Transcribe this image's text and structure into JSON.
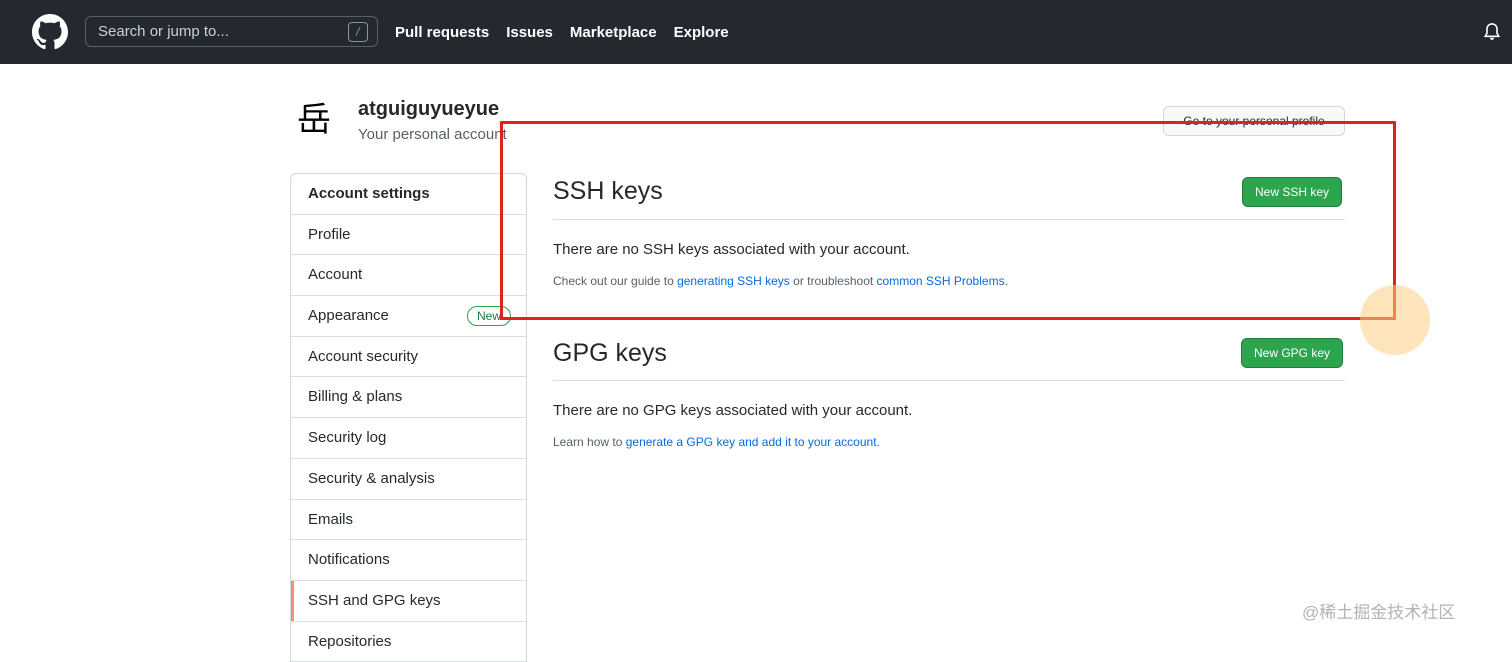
{
  "header": {
    "search_placeholder": "Search or jump to...",
    "search_shortcut": "/",
    "nav": [
      "Pull requests",
      "Issues",
      "Marketplace",
      "Explore"
    ]
  },
  "account": {
    "avatar_glyph": "岳",
    "username": "atguiguyueyue",
    "subtitle": "Your personal account",
    "profile_button": "Go to your personal profile"
  },
  "sidebar": {
    "heading": "Account settings",
    "items": [
      {
        "label": "Profile"
      },
      {
        "label": "Account"
      },
      {
        "label": "Appearance",
        "badge": "New"
      },
      {
        "label": "Account security"
      },
      {
        "label": "Billing & plans"
      },
      {
        "label": "Security log"
      },
      {
        "label": "Security & analysis"
      },
      {
        "label": "Emails"
      },
      {
        "label": "Notifications"
      },
      {
        "label": "SSH and GPG keys",
        "selected": true
      },
      {
        "label": "Repositories"
      }
    ]
  },
  "ssh": {
    "title": "SSH keys",
    "button": "New SSH key",
    "empty": "There are no SSH keys associated with your account.",
    "help_prefix": "Check out our guide to ",
    "help_link1": "generating SSH keys",
    "help_middle": " or troubleshoot ",
    "help_link2": "common SSH Problems",
    "help_suffix": "."
  },
  "gpg": {
    "title": "GPG keys",
    "button": "New GPG key",
    "empty": "There are no GPG keys associated with your account.",
    "help_prefix": "Learn how to ",
    "help_link": "generate a GPG key and add it to your account",
    "help_suffix": "."
  },
  "watermark": "@稀土掘金技术社区",
  "colors": {
    "header_bg": "#24292f",
    "primary_green": "#2da44e",
    "link_blue": "#0969da",
    "selected_marker": "#fd8c73",
    "annotation_red": "#e0221b"
  }
}
